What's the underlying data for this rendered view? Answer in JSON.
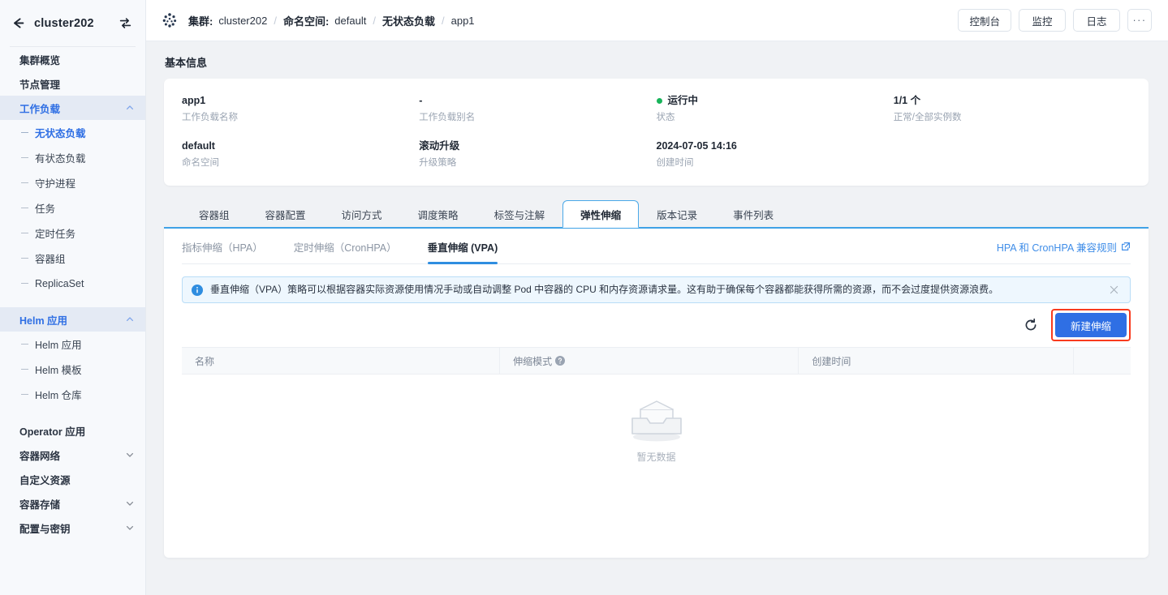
{
  "sidebar": {
    "cluster_name": "cluster202",
    "back_icon": "arrow-left-icon",
    "switch_icon": "swap-icon",
    "items": [
      {
        "label": "集群概览",
        "type": "item",
        "active": false
      },
      {
        "label": "节点管理",
        "type": "item",
        "active": false
      },
      {
        "label": "工作负载",
        "type": "group",
        "active": true,
        "expanded": true
      },
      {
        "label": "无状态负载",
        "type": "sub",
        "active": true
      },
      {
        "label": "有状态负载",
        "type": "sub",
        "active": false
      },
      {
        "label": "守护进程",
        "type": "sub",
        "active": false
      },
      {
        "label": "任务",
        "type": "sub",
        "active": false
      },
      {
        "label": "定时任务",
        "type": "sub",
        "active": false
      },
      {
        "label": "容器组",
        "type": "sub",
        "active": false
      },
      {
        "label": "ReplicaSet",
        "type": "sub",
        "active": false
      },
      {
        "label": "Helm 应用",
        "type": "group",
        "active": true,
        "expanded": true
      },
      {
        "label": "Helm 应用",
        "type": "sub",
        "active": false
      },
      {
        "label": "Helm 模板",
        "type": "sub",
        "active": false
      },
      {
        "label": "Helm 仓库",
        "type": "sub",
        "active": false
      },
      {
        "label": "Operator 应用",
        "type": "item",
        "active": false
      },
      {
        "label": "容器网络",
        "type": "group",
        "active": false,
        "expanded": false
      },
      {
        "label": "自定义资源",
        "type": "item",
        "active": false
      },
      {
        "label": "容器存储",
        "type": "group",
        "active": false,
        "expanded": false
      },
      {
        "label": "配置与密钥",
        "type": "group",
        "active": false,
        "expanded": false
      }
    ]
  },
  "topbar": {
    "brand_icon": "cluster-dots-icon",
    "breadcrumb": {
      "cluster_label": "集群:",
      "cluster_value": "cluster202",
      "namespace_label": "命名空间:",
      "namespace_value": "default",
      "workload_type": "无状态负载",
      "workload_name": "app1",
      "separator": "/"
    },
    "actions": [
      {
        "label": "控制台",
        "name": "console-button"
      },
      {
        "label": "监控",
        "name": "monitor-button"
      },
      {
        "label": "日志",
        "name": "logs-button"
      },
      {
        "label": "···",
        "name": "more-actions-button"
      }
    ]
  },
  "basic_info": {
    "title": "基本信息",
    "fields": [
      {
        "value": "app1",
        "label": "工作负载名称",
        "status": false
      },
      {
        "value": "-",
        "label": "工作负载别名",
        "status": false
      },
      {
        "value": "运行中",
        "label": "状态",
        "status": true,
        "status_color": "#18b45a"
      },
      {
        "value": "1/1 个",
        "label": "正常/全部实例数",
        "status": false
      },
      {
        "value": "default",
        "label": "命名空间",
        "status": false
      },
      {
        "value": "滚动升级",
        "label": "升级策略",
        "status": false
      },
      {
        "value": "2024-07-05 14:16",
        "label": "创建时间",
        "status": false
      },
      {
        "value": "",
        "label": "",
        "status": false
      }
    ]
  },
  "tabs": [
    {
      "label": "容器组",
      "active": false
    },
    {
      "label": "容器配置",
      "active": false
    },
    {
      "label": "访问方式",
      "active": false
    },
    {
      "label": "调度策略",
      "active": false
    },
    {
      "label": "标签与注解",
      "active": false
    },
    {
      "label": "弹性伸缩",
      "active": true
    },
    {
      "label": "版本记录",
      "active": false
    },
    {
      "label": "事件列表",
      "active": false
    }
  ],
  "subtabs": [
    {
      "label": "指标伸缩（HPA）",
      "active": false
    },
    {
      "label": "定时伸缩（CronHPA）",
      "active": false
    },
    {
      "label": "垂直伸缩 (VPA)",
      "active": true
    }
  ],
  "rule_link": {
    "label": "HPA 和 CronHPA 兼容规则",
    "icon": "external-link-icon"
  },
  "alert": {
    "icon": "info-circle-icon",
    "text": "垂直伸缩（VPA）策略可以根据容器实际资源使用情况手动或自动调整 Pod 中容器的 CPU 和内存资源请求量。这有助于确保每个容器都能获得所需的资源，而不会过度提供资源浪费。",
    "close_icon": "close-icon"
  },
  "toolbar": {
    "refresh_icon": "refresh-icon",
    "create_label": "新建伸缩",
    "highlight_color": "#f93b1e",
    "primary_color": "#2f6fe4"
  },
  "table": {
    "columns": [
      {
        "label": "名称",
        "help": false
      },
      {
        "label": "伸缩模式",
        "help": true,
        "help_icon": "question-circle-icon"
      },
      {
        "label": "创建时间",
        "help": false
      },
      {
        "label": "",
        "help": false
      }
    ],
    "rows": [],
    "empty_text": "暂无数据",
    "empty_icon": "empty-inbox-icon"
  }
}
